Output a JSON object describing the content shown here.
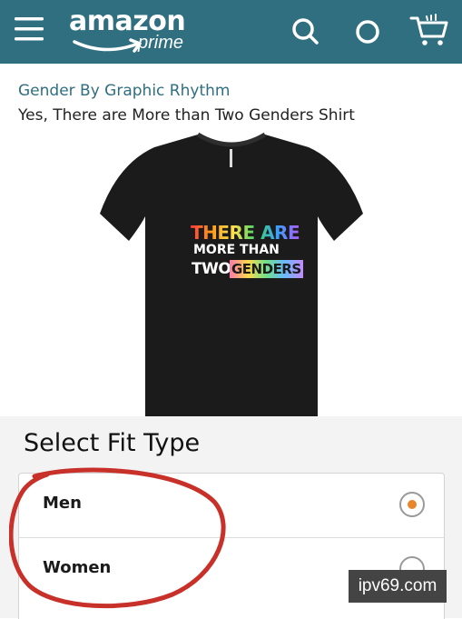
{
  "header": {
    "logo": {
      "word": "amazon",
      "sub": "prime"
    },
    "icons": {
      "menu": "hamburger-menu-icon",
      "search": "search-icon",
      "ring": "ring-icon",
      "cart": "cart-icon"
    },
    "background": "#2f6f80"
  },
  "product": {
    "brand": "Gender By Graphic Rhythm",
    "title": "Yes, There are More than Two Genders Shirt",
    "shirt_print": {
      "line1": "THERE ARE",
      "line2": "MORE THAN",
      "line3_a": "TWO",
      "line3_b": "GENDERS"
    }
  },
  "fit_type": {
    "heading": "Select Fit Type",
    "options": [
      {
        "label": "Men",
        "selected": true
      },
      {
        "label": "Women",
        "selected": false
      }
    ],
    "accent": "#e8872a"
  },
  "watermark": "ipv69.com"
}
